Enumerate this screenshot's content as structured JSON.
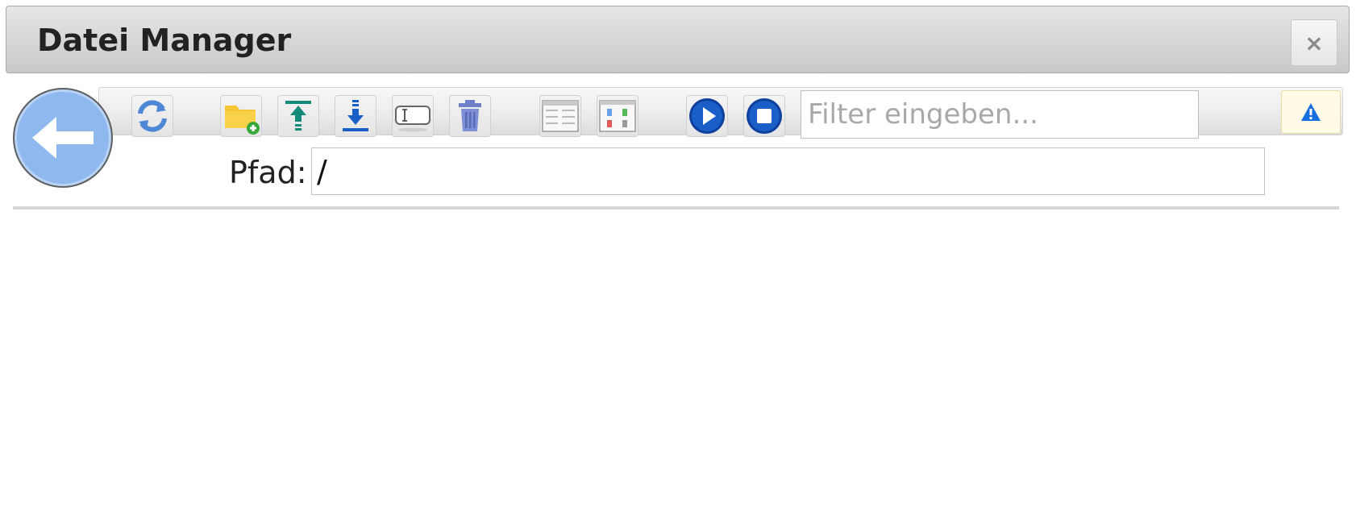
{
  "window": {
    "title": "Datei Manager",
    "close_label": "×"
  },
  "toolbar": {
    "back_icon": "arrow-left-icon",
    "buttons": [
      {
        "name": "refresh-button",
        "icon": "refresh-icon"
      },
      {
        "name": "new-folder-button",
        "icon": "folder-add-icon"
      },
      {
        "name": "upload-button",
        "icon": "upload-icon"
      },
      {
        "name": "download-button",
        "icon": "download-icon"
      },
      {
        "name": "rename-button",
        "icon": "rename-icon"
      },
      {
        "name": "delete-button",
        "icon": "trash-icon"
      },
      {
        "name": "list-view-button",
        "icon": "list-view-icon"
      },
      {
        "name": "tile-view-button",
        "icon": "tile-view-icon"
      },
      {
        "name": "play-button",
        "icon": "play-icon"
      },
      {
        "name": "stop-button",
        "icon": "stop-icon"
      }
    ],
    "filter": {
      "placeholder": "Filter eingeben...",
      "value": ""
    },
    "warning_icon": "warning-icon"
  },
  "path": {
    "label": "Pfad:",
    "value": "/"
  },
  "colors": {
    "accent_blue": "#1a5fc7",
    "back_circle": "#8fb8ee",
    "teal": "#138a7a",
    "folder_yellow": "#f7c531"
  }
}
